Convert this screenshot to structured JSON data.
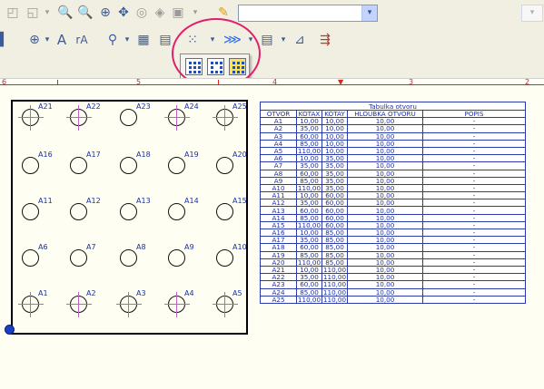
{
  "toolbar1": {
    "icons": [
      "zoom-to-fit-icon",
      "zoom-window-icon",
      "zoom-in-icon",
      "zoom-out-icon",
      "zoom-realtime-icon",
      "pan-icon",
      "zoom-previous-icon",
      "3d-view-icon",
      "layer-icon",
      "paint-icon"
    ],
    "combo_value": "",
    "combo_arrow": "▾",
    "combo2_arrow": "▾"
  },
  "toolbar2": {
    "icons": [
      "plus-circle-icon",
      "text-icon",
      "text-arc-icon",
      "magnifier-icon",
      "table-icon",
      "grid-icon",
      "hole-pattern-icon",
      "arrows-icon",
      "table-list-icon",
      "ruler-icon",
      "export-icon"
    ],
    "text_letter": "A",
    "text_arc_letter": "rA"
  },
  "dropdown": {
    "items": [
      "hole-grid-blue-icon",
      "hole-grid-dense-icon",
      "hole-grid-yellow-icon"
    ]
  },
  "ruler": {
    "numbers": [
      "6",
      "5",
      "4",
      "3",
      "2"
    ],
    "color": "#d52626"
  },
  "drawing": {
    "holes": [
      {
        "label": "A21",
        "marked": true
      },
      {
        "label": "A22",
        "marked": true
      },
      {
        "label": "A23",
        "marked": false
      },
      {
        "label": "A24",
        "marked": true
      },
      {
        "label": "A25",
        "marked": true
      },
      {
        "label": "A16",
        "marked": false
      },
      {
        "label": "A17",
        "marked": false
      },
      {
        "label": "A18",
        "marked": false
      },
      {
        "label": "A19",
        "marked": false
      },
      {
        "label": "A20",
        "marked": false
      },
      {
        "label": "A11",
        "marked": false
      },
      {
        "label": "A12",
        "marked": false
      },
      {
        "label": "A13",
        "marked": false
      },
      {
        "label": "A14",
        "marked": false
      },
      {
        "label": "A15",
        "marked": false
      },
      {
        "label": "A6",
        "marked": false
      },
      {
        "label": "A7",
        "marked": false
      },
      {
        "label": "A8",
        "marked": false
      },
      {
        "label": "A9",
        "marked": false
      },
      {
        "label": "A10",
        "marked": false
      },
      {
        "label": "A1",
        "marked": true
      },
      {
        "label": "A2",
        "marked": true
      },
      {
        "label": "A3",
        "marked": true
      },
      {
        "label": "A4",
        "marked": true
      },
      {
        "label": "A5",
        "marked": true
      }
    ]
  },
  "table": {
    "title": "Tabulka otvoru",
    "headers": [
      "OTVOR",
      "KÓTAX",
      "KÓTAY",
      "HLOUBKA OTVORU",
      "POPIS"
    ],
    "rows": [
      [
        "A1",
        "10,00",
        "10,00",
        "10,00",
        "-"
      ],
      [
        "A2",
        "35,00",
        "10,00",
        "10,00",
        "-"
      ],
      [
        "A3",
        "60,00",
        "10,00",
        "10,00",
        "-"
      ],
      [
        "A4",
        "85,00",
        "10,00",
        "10,00",
        "-"
      ],
      [
        "A5",
        "110,00",
        "10,00",
        "10,00",
        "-"
      ],
      [
        "A6",
        "10,00",
        "35,00",
        "10,00",
        "-"
      ],
      [
        "A7",
        "35,00",
        "35,00",
        "10,00",
        "-"
      ],
      [
        "A8",
        "60,00",
        "35,00",
        "10,00",
        "-"
      ],
      [
        "A9",
        "85,00",
        "35,00",
        "10,00",
        "-"
      ],
      [
        "A10",
        "110,00",
        "35,00",
        "10,00",
        "-"
      ],
      [
        "A11",
        "10,00",
        "60,00",
        "10,00",
        "-"
      ],
      [
        "A12",
        "35,00",
        "60,00",
        "10,00",
        "-"
      ],
      [
        "A13",
        "60,00",
        "60,00",
        "10,00",
        "-"
      ],
      [
        "A14",
        "85,00",
        "60,00",
        "10,00",
        "-"
      ],
      [
        "A15",
        "110,00",
        "60,00",
        "10,00",
        "-"
      ],
      [
        "A16",
        "10,00",
        "85,00",
        "10,00",
        "-"
      ],
      [
        "A17",
        "35,00",
        "85,00",
        "10,00",
        "-"
      ],
      [
        "A18",
        "60,00",
        "85,00",
        "10,00",
        "-"
      ],
      [
        "A19",
        "85,00",
        "85,00",
        "10,00",
        "-"
      ],
      [
        "A20",
        "110,00",
        "85,00",
        "10,00",
        "-"
      ],
      [
        "A21",
        "10,00",
        "110,00",
        "10,00",
        "-"
      ],
      [
        "A22",
        "35,00",
        "110,00",
        "10,00",
        "-"
      ],
      [
        "A23",
        "60,00",
        "110,00",
        "10,00",
        "-"
      ],
      [
        "A24",
        "85,00",
        "110,00",
        "10,00",
        "-"
      ],
      [
        "A25",
        "110,00",
        "110,00",
        "10,00",
        "-"
      ]
    ]
  },
  "colors": {
    "highlight_circle": "#e0206a",
    "table_text": "#1c2ea6",
    "hole_label": "#1a2fa0",
    "center_mark": "#c05fc8"
  }
}
